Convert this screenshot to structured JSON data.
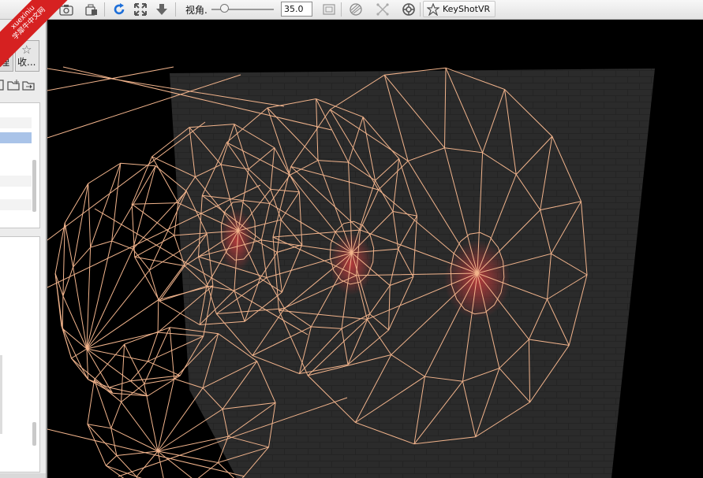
{
  "toolbar": {
    "fov_label": "视角.",
    "fov_value": "35.0",
    "fov_slider_fraction": 0.2,
    "keyshotvr_label": "KeyShotVR",
    "icons": [
      "camera-icon",
      "lock-camera-icon",
      "refresh-icon",
      "fit-view-icon",
      "download-icon",
      "grid-icon",
      "render-settings-icon",
      "region-icon",
      "denoise-icon",
      "keyshotvr-icon"
    ],
    "colors": {
      "refresh": "#1e6fd9",
      "toolbar_bg": "#ececec"
    }
  },
  "left_panel": {
    "close_glyph": "✕",
    "tab_partial_label": "理",
    "tab_favorites_label": "收...",
    "star_glyph": "☆"
  },
  "viewport": {
    "wire_color": "#f2b48c",
    "background": "#000000",
    "backplate_color": "#2b2b2b"
  },
  "watermark": {
    "line1": "xuexiniu",
    "line2": "学犀牛中文网",
    "color": "#d62121"
  }
}
